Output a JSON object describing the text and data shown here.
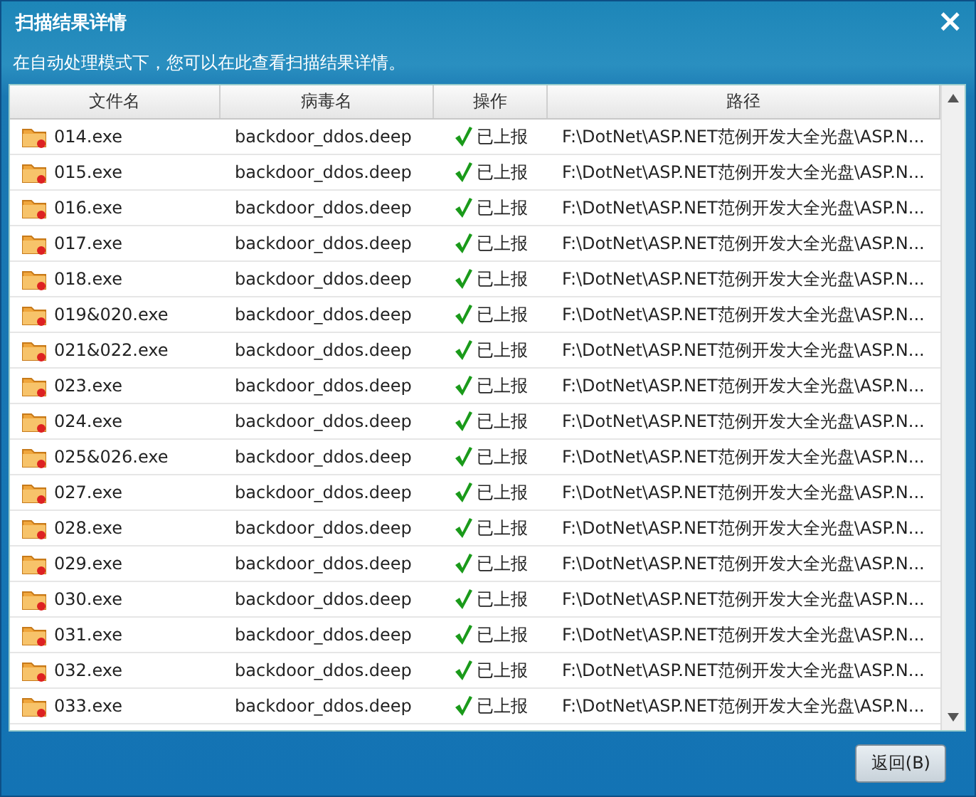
{
  "window": {
    "title": "扫描结果详情",
    "close": "×"
  },
  "subtitle": "在自动处理模式下，您可以在此查看扫描结果详情。",
  "table": {
    "columns": [
      "文件名",
      "病毒名",
      "操作",
      "路径"
    ],
    "rows": [
      {
        "file": "014.exe",
        "virus": "backdoor_ddos.deep",
        "action": "已上报",
        "path": "F:\\DotNet\\ASP.NET范例开发大全光盘\\ASP.N..."
      },
      {
        "file": "015.exe",
        "virus": "backdoor_ddos.deep",
        "action": "已上报",
        "path": "F:\\DotNet\\ASP.NET范例开发大全光盘\\ASP.N..."
      },
      {
        "file": "016.exe",
        "virus": "backdoor_ddos.deep",
        "action": "已上报",
        "path": "F:\\DotNet\\ASP.NET范例开发大全光盘\\ASP.N..."
      },
      {
        "file": "017.exe",
        "virus": "backdoor_ddos.deep",
        "action": "已上报",
        "path": "F:\\DotNet\\ASP.NET范例开发大全光盘\\ASP.N..."
      },
      {
        "file": "018.exe",
        "virus": "backdoor_ddos.deep",
        "action": "已上报",
        "path": "F:\\DotNet\\ASP.NET范例开发大全光盘\\ASP.N..."
      },
      {
        "file": "019&020.exe",
        "virus": "backdoor_ddos.deep",
        "action": "已上报",
        "path": "F:\\DotNet\\ASP.NET范例开发大全光盘\\ASP.N..."
      },
      {
        "file": "021&022.exe",
        "virus": "backdoor_ddos.deep",
        "action": "已上报",
        "path": "F:\\DotNet\\ASP.NET范例开发大全光盘\\ASP.N..."
      },
      {
        "file": "023.exe",
        "virus": "backdoor_ddos.deep",
        "action": "已上报",
        "path": "F:\\DotNet\\ASP.NET范例开发大全光盘\\ASP.N..."
      },
      {
        "file": "024.exe",
        "virus": "backdoor_ddos.deep",
        "action": "已上报",
        "path": "F:\\DotNet\\ASP.NET范例开发大全光盘\\ASP.N..."
      },
      {
        "file": "025&026.exe",
        "virus": "backdoor_ddos.deep",
        "action": "已上报",
        "path": "F:\\DotNet\\ASP.NET范例开发大全光盘\\ASP.N..."
      },
      {
        "file": "027.exe",
        "virus": "backdoor_ddos.deep",
        "action": "已上报",
        "path": "F:\\DotNet\\ASP.NET范例开发大全光盘\\ASP.N..."
      },
      {
        "file": "028.exe",
        "virus": "backdoor_ddos.deep",
        "action": "已上报",
        "path": "F:\\DotNet\\ASP.NET范例开发大全光盘\\ASP.N..."
      },
      {
        "file": "029.exe",
        "virus": "backdoor_ddos.deep",
        "action": "已上报",
        "path": "F:\\DotNet\\ASP.NET范例开发大全光盘\\ASP.N..."
      },
      {
        "file": "030.exe",
        "virus": "backdoor_ddos.deep",
        "action": "已上报",
        "path": "F:\\DotNet\\ASP.NET范例开发大全光盘\\ASP.N..."
      },
      {
        "file": "031.exe",
        "virus": "backdoor_ddos.deep",
        "action": "已上报",
        "path": "F:\\DotNet\\ASP.NET范例开发大全光盘\\ASP.N..."
      },
      {
        "file": "032.exe",
        "virus": "backdoor_ddos.deep",
        "action": "已上报",
        "path": "F:\\DotNet\\ASP.NET范例开发大全光盘\\ASP.N..."
      },
      {
        "file": "033.exe",
        "virus": "backdoor_ddos.deep",
        "action": "已上报",
        "path": "F:\\DotNet\\ASP.NET范例开发大全光盘\\ASP.N..."
      }
    ]
  },
  "buttons": [
    "返回(B)"
  ]
}
